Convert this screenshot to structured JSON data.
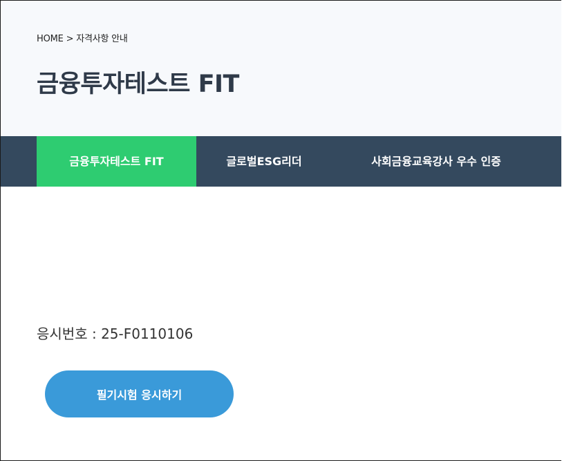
{
  "breadcrumb": {
    "text": "HOME > 자격사항 안내"
  },
  "page": {
    "title": "금융투자테스트 FIT"
  },
  "tabs": [
    {
      "label": "금융투자테스트 FIT",
      "active": true
    },
    {
      "label": "글로벌ESG리더",
      "active": false
    },
    {
      "label": "사회금융교육강사 우수 인증",
      "active": false
    }
  ],
  "exam": {
    "label": "응시번호 : ",
    "number": "25-F0110106"
  },
  "actions": {
    "take_exam_label": "필기시험 응시하기"
  },
  "colors": {
    "header_bg": "#f7f9fc",
    "tabbar_bg": "#34495e",
    "active_tab": "#2ecc71",
    "button": "#3a9ad9"
  }
}
